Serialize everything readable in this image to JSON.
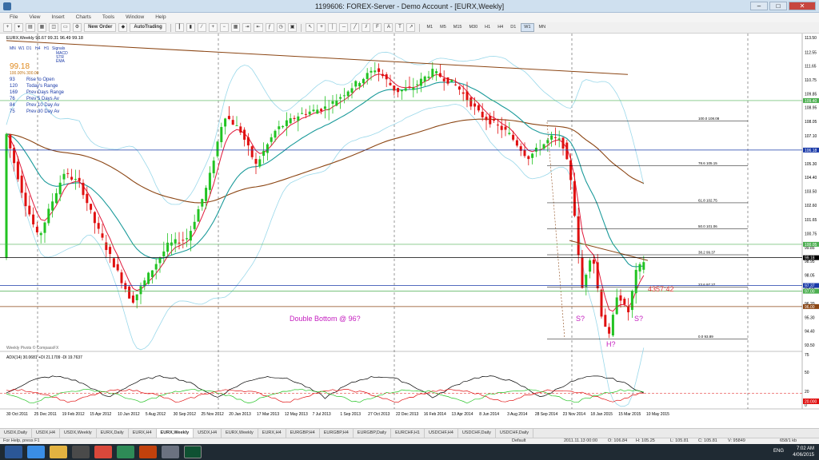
{
  "window": {
    "title": "1199606: FOREX-Server - Demo Account - [EURX,Weekly]",
    "buttons": [
      "–",
      "□",
      "✕"
    ]
  },
  "menu": [
    "File",
    "View",
    "Insert",
    "Charts",
    "Tools",
    "Window",
    "Help"
  ],
  "toolbar": {
    "new_order": "New Order",
    "autotrading": "AutoTrading",
    "timeframes": [
      "M1",
      "M5",
      "M15",
      "M30",
      "H1",
      "H4",
      "D1",
      "W1",
      "MN"
    ],
    "active_timeframe": "W1"
  },
  "chart": {
    "header": "EURX,Weekly  96.67 99.31 96.49 99.18",
    "period_tabs": [
      "MN",
      "W1",
      "D1",
      "H4",
      "H1",
      "Signals"
    ],
    "signal_rows": [
      "MACD",
      "STR",
      "EMA"
    ],
    "price_big": "99.18",
    "price_sub": "100.00%  300.00",
    "stats": [
      {
        "num": "93",
        "label": "Rise to Open"
      },
      {
        "num": "120",
        "label": "Today's Range"
      },
      {
        "num": "169",
        "label": "Prev Days Range"
      },
      {
        "num": "76",
        "label": "Prev 5 Days Av"
      },
      {
        "num": "84",
        "label": "Prev 10 Day Av"
      },
      {
        "num": "75",
        "label": "Prev 30 Day Av"
      }
    ],
    "annotations": {
      "double_bottom": "Double Bottom @ 96?",
      "s_left": "S?",
      "s_right": "S?",
      "head": "H?",
      "countdown": "4357:42"
    },
    "watermark": "Weekly Pivots © CompassFX",
    "fib_levels": [
      {
        "pct": "100.0",
        "price": "108.08"
      },
      {
        "pct": "78.6",
        "price": "105.15"
      },
      {
        "pct": "61.8",
        "price": "102.75"
      },
      {
        "pct": "50.0",
        "price": "101.06"
      },
      {
        "pct": "38.2",
        "price": "99.37"
      },
      {
        "pct": "23.6",
        "price": "97.27"
      },
      {
        "pct": "0.0",
        "price": "93.89"
      }
    ],
    "price_axis": [
      "113.50",
      "112.55",
      "111.65",
      "110.75",
      "109.85",
      "108.95",
      "108.05",
      "107.10",
      "106.20",
      "105.30",
      "104.40",
      "103.50",
      "102.60",
      "101.65",
      "100.75",
      "99.85",
      "98.95",
      "98.05",
      "97.10",
      "96.20",
      "95.30",
      "94.40",
      "93.50"
    ],
    "axis_markers": [
      {
        "price": "109.40",
        "color": "#4caf50"
      },
      {
        "price": "106.18",
        "color": "#1a3aa8"
      },
      {
        "price": "100.05",
        "color": "#4caf50"
      },
      {
        "price": "99.18",
        "color": "#000000"
      },
      {
        "price": "97.37",
        "color": "#1a3aa8"
      },
      {
        "price": "97.00",
        "color": "#4caf50"
      },
      {
        "price": "96.00",
        "color": "#8b4513"
      }
    ],
    "adx_label": "ADX(14) 30.0681  +DI 21.1709  -DI 19.7637",
    "adx_axis": [
      "75",
      "50",
      "20",
      "0"
    ],
    "adx_marker": "20.000",
    "date_axis": [
      "30 Oct 2011",
      "25 Dec 2011",
      "19 Feb 2012",
      "15 Apr 2012",
      "10 Jun 2012",
      "5 Aug 2012",
      "30 Sep 2012",
      "25 Nov 2012",
      "20 Jan 2013",
      "17 Mar 2013",
      "12 May 2013",
      "7 Jul 2013",
      "1 Sep 2013",
      "27 Oct 2013",
      "22 Dec 2013",
      "16 Feb 2014",
      "13 Apr 2014",
      "8 Jun 2014",
      "3 Aug 2014",
      "28 Sep 2014",
      "23 Nov 2014",
      "18 Jan 2015",
      "15 Mar 2015",
      "10 May 2015"
    ]
  },
  "tabs": [
    "USDX,Daily",
    "USDX,H4",
    "USDX,Weekly",
    "EURX,Daily",
    "EURX,H4",
    "EURX,Weekly",
    "USDX,H4",
    "EURX,Weekly",
    "EURX,H4",
    "EURGBP,H4",
    "EURGBP,H4",
    "EURGBP,Daily",
    "EURCHF,H1",
    "USDCHF,H4",
    "USDCHF,Daily",
    "USDCHF,Daily"
  ],
  "active_tab_index": 5,
  "status": {
    "help": "For Help, press F1",
    "profile": "Default",
    "time": "2011.11.13 00:00",
    "o": "O: 106.84",
    "h": "H: 105.25",
    "l": "L: 105.81",
    "c": "C: 105.81",
    "v": "V: 95849",
    "traffic": "658/1 kb"
  },
  "taskbar": {
    "time": "7:02 AM",
    "date": "4/06/2015",
    "lang": "ENG"
  },
  "colors": {
    "bull": "#22c322",
    "bear": "#e01010",
    "ema_fast": "#e0183a",
    "ema_slow": "#1a9a9a",
    "ma_long": "#8b4513",
    "bands": "#9ad8ea",
    "annotation": "#c41dbf"
  }
}
